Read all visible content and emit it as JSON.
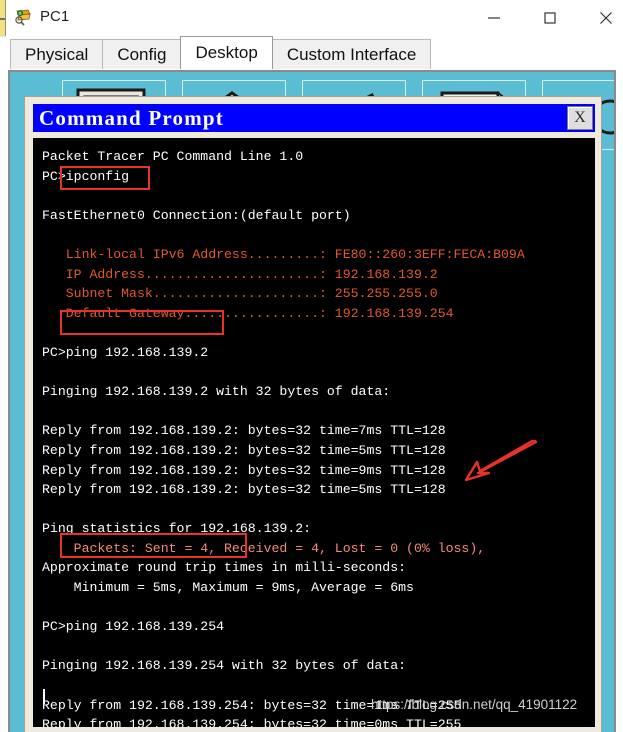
{
  "window": {
    "title": "PC1",
    "app_icon": "packet-tracer-pc-icon",
    "controls": {
      "minimize": "—",
      "maximize": "□",
      "close": "✕"
    }
  },
  "tabs": [
    {
      "label": "Physical",
      "active": false
    },
    {
      "label": "Config",
      "active": false
    },
    {
      "label": "Desktop",
      "active": true
    },
    {
      "label": "Custom Interface",
      "active": false
    }
  ],
  "desktop": {
    "background_color": "#5bbdd4",
    "icons": [
      {
        "name": "ip-configuration-icon"
      },
      {
        "name": "dial-up-icon"
      },
      {
        "name": "terminal-icon"
      },
      {
        "name": "command-prompt-icon"
      },
      {
        "name": "web-browser-icon"
      }
    ]
  },
  "command_prompt": {
    "title": "Command Prompt",
    "title_bar_color": "#0000ff",
    "close_label": "X",
    "console_bg": "#000000",
    "lines": [
      {
        "text": "Packet Tracer PC Command Line 1.0",
        "color": "white"
      },
      {
        "text": "PC>ipconfig",
        "color": "white"
      },
      {
        "text": "",
        "color": "blank"
      },
      {
        "text": "FastEthernet0 Connection:(default port)",
        "color": "white"
      },
      {
        "text": "",
        "color": "blank"
      },
      {
        "text": "   Link-local IPv6 Address.........: FE80::260:3EFF:FECA:B09A",
        "color": "orange"
      },
      {
        "text": "   IP Address......................: 192.168.139.2",
        "color": "orange"
      },
      {
        "text": "   Subnet Mask.....................: 255.255.255.0",
        "color": "orange"
      },
      {
        "text": "   Default Gateway.................: 192.168.139.254",
        "color": "orange"
      },
      {
        "text": "",
        "color": "blank"
      },
      {
        "text": "PC>ping 192.168.139.2",
        "color": "white"
      },
      {
        "text": "",
        "color": "blank"
      },
      {
        "text": "Pinging 192.168.139.2 with 32 bytes of data:",
        "color": "white"
      },
      {
        "text": "",
        "color": "blank"
      },
      {
        "text": "Reply from 192.168.139.2: bytes=32 time=7ms TTL=128",
        "color": "white"
      },
      {
        "text": "Reply from 192.168.139.2: bytes=32 time=5ms TTL=128",
        "color": "white"
      },
      {
        "text": "Reply from 192.168.139.2: bytes=32 time=9ms TTL=128",
        "color": "white"
      },
      {
        "text": "Reply from 192.168.139.2: bytes=32 time=5ms TTL=128",
        "color": "white"
      },
      {
        "text": "",
        "color": "blank"
      },
      {
        "text": "Ping statistics for 192.168.139.2:",
        "color": "white"
      },
      {
        "text": "    Packets: Sent = 4, Received = 4, Lost = 0 (0% loss),",
        "color": "salmon"
      },
      {
        "text": "Approximate round trip times in milli-seconds:",
        "color": "white"
      },
      {
        "text": "    Minimum = 5ms, Maximum = 9ms, Average = 6ms",
        "color": "white"
      },
      {
        "text": "",
        "color": "blank"
      },
      {
        "text": "PC>ping 192.168.139.254",
        "color": "white"
      },
      {
        "text": "",
        "color": "blank"
      },
      {
        "text": "Pinging 192.168.139.254 with 32 bytes of data:",
        "color": "white"
      },
      {
        "text": "",
        "color": "blank"
      },
      {
        "text": "Reply from 192.168.139.254: bytes=32 time=1ms TTL=255",
        "color": "white"
      },
      {
        "text": "Reply from 192.168.139.254: bytes=32 time=0ms TTL=255",
        "color": "white"
      }
    ]
  },
  "annotations": {
    "color": "#e8322a",
    "boxes": [
      {
        "name": "highlight-ipconfig-command",
        "target": "ipconfig"
      },
      {
        "name": "highlight-ping-host-command",
        "target": "ping 192.168.139.2"
      },
      {
        "name": "highlight-ping-gateway-command",
        "target": "ping 192.168.139.254"
      }
    ],
    "arrow": {
      "name": "arrow-to-packet-loss",
      "target": "(0% loss),"
    }
  },
  "watermark": {
    "text": "https://blog.csdn.net/qq_41901122",
    "color": "#cfcfcf"
  }
}
